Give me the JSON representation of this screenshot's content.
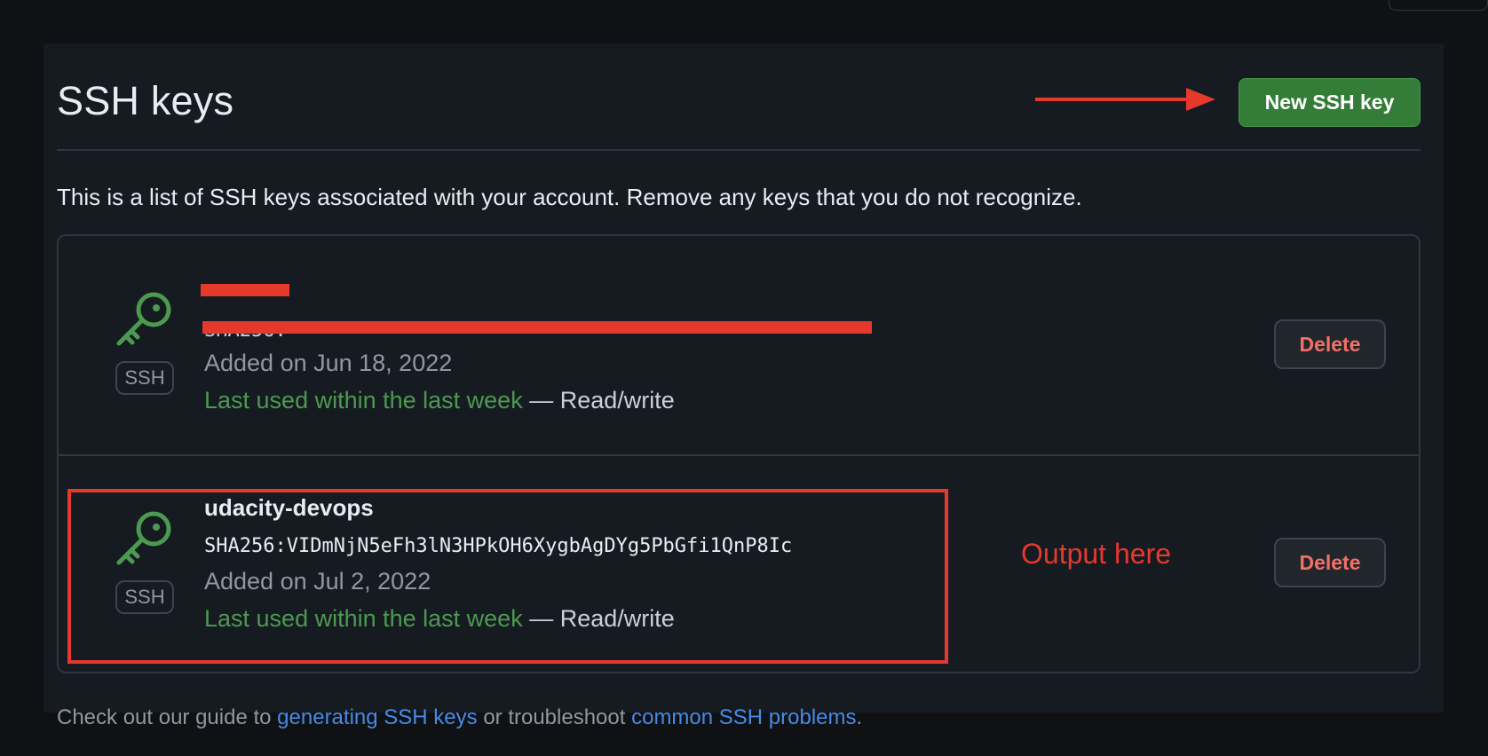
{
  "page": {
    "title": "SSH keys",
    "new_key_button": "New SSH key",
    "intro": "This is a list of SSH keys associated with your account. Remove any keys that you do not recognize."
  },
  "keys": [
    {
      "name": "",
      "fingerprint": "SHA256:",
      "added": "Added on Jun 18, 2022",
      "last_used": "Last used within the last week",
      "separator": "—",
      "access": "Read/write",
      "badge": "SSH",
      "delete_label": "Delete",
      "icon": "key-icon",
      "redacted": true
    },
    {
      "name": "udacity-devops",
      "fingerprint": "SHA256:VIDmNjN5eFh3lN3HPkOH6XygbAgDYg5PbGfi1QnP8Ic",
      "added": "Added on Jul 2, 2022",
      "last_used": "Last used within the last week",
      "separator": "—",
      "access": "Read/write",
      "badge": "SSH",
      "delete_label": "Delete",
      "icon": "key-icon",
      "redacted": false
    }
  ],
  "annotation": {
    "text": "Output here"
  },
  "footer": {
    "prefix": "Check out our guide to",
    "link1": "generating SSH keys",
    "middle": "or troubleshoot",
    "link2": "common SSH problems",
    "suffix": "."
  },
  "colors": {
    "background": "#0f1115",
    "panel": "#161b22",
    "border": "#30363d",
    "accent_green": "#347d39",
    "usage_green": "#4c9a4f",
    "danger": "#f47067",
    "link": "#478be6",
    "annotation_red": "#e5392c"
  }
}
